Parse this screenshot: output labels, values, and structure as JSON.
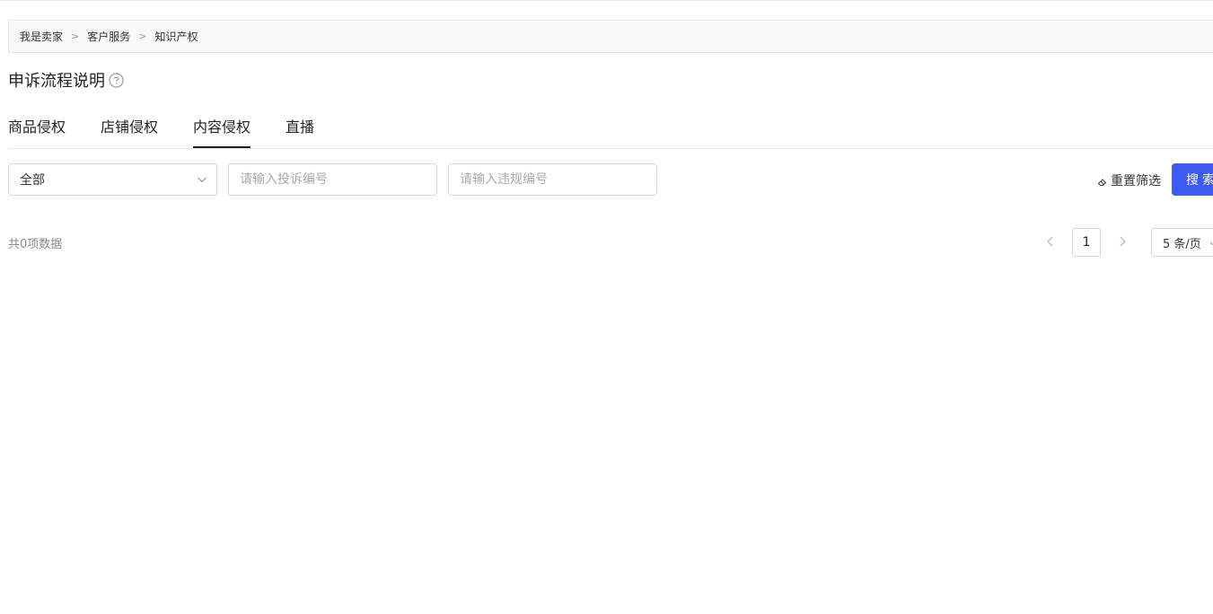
{
  "breadcrumb": {
    "items": [
      "我是卖家",
      "客户服务",
      "知识产权"
    ],
    "separator": ">"
  },
  "page": {
    "title": "申诉流程说明",
    "help_icon": "question-circle-icon"
  },
  "tabs": [
    {
      "label": "商品侵权",
      "active": false
    },
    {
      "label": "店铺侵权",
      "active": false
    },
    {
      "label": "内容侵权",
      "active": true
    },
    {
      "label": "直播",
      "active": false
    }
  ],
  "filters": {
    "status_select": {
      "value": "全部",
      "icon": "chevron-down-icon"
    },
    "complaint_input": {
      "value": "",
      "placeholder": "请输入投诉编号"
    },
    "violation_input": {
      "value": "",
      "placeholder": "请输入违规编号"
    },
    "reset_label": "重置筛选",
    "reset_icon": "eraser-icon",
    "search_label": "搜索"
  },
  "results": {
    "total_text": "共0项数据"
  },
  "pagination": {
    "current_page": "1",
    "page_size": "5 条/页",
    "prev_icon": "chevron-left-icon",
    "next_icon": "chevron-right-icon"
  },
  "colors": {
    "accent": "#3d5af1",
    "breadcrumb_bg": "#f8f8f8",
    "border": "#d9d9d9"
  }
}
